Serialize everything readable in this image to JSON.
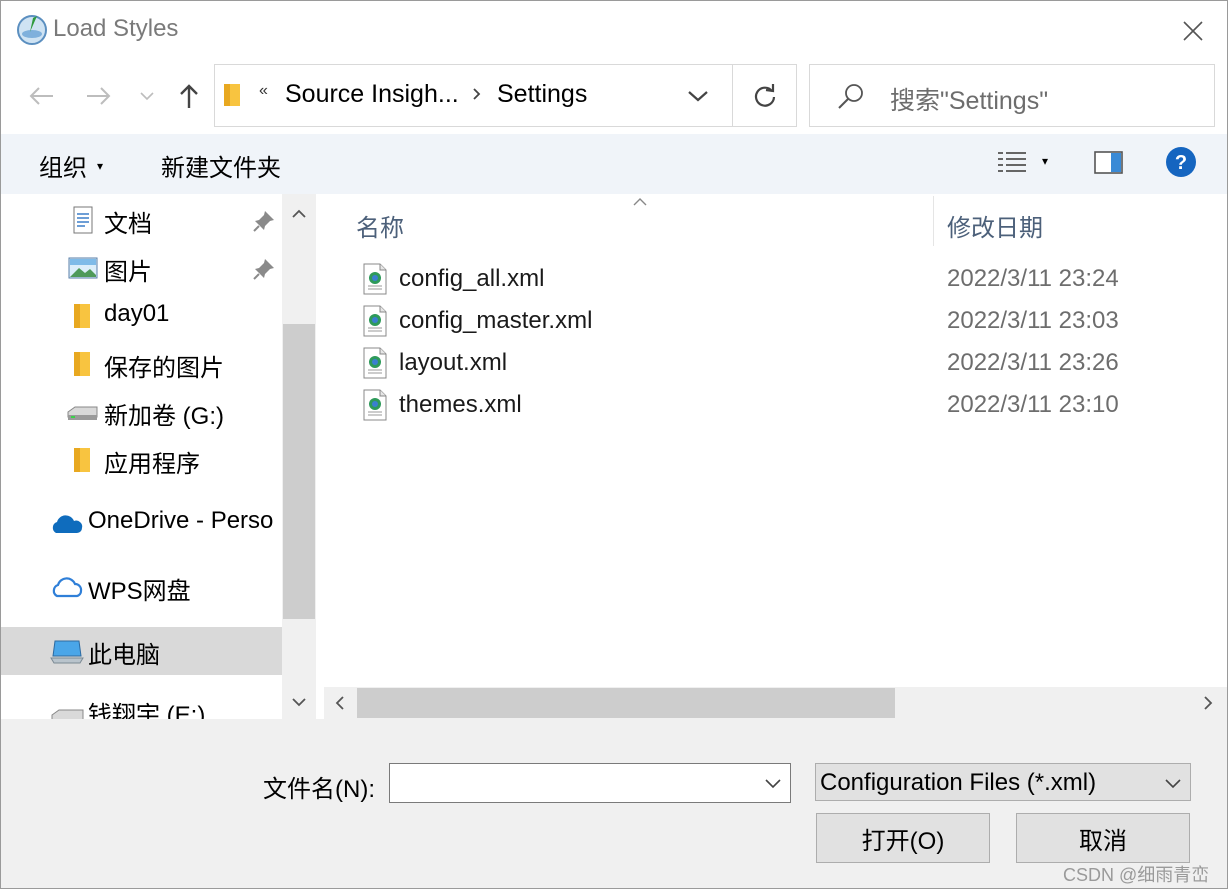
{
  "window": {
    "title": "Load Styles"
  },
  "address": {
    "overflow_chevron": "«",
    "crumbs": [
      "Source Insigh...",
      "Settings"
    ]
  },
  "search": {
    "placeholder": "搜索\"Settings\""
  },
  "toolbar": {
    "organize_label": "组织",
    "organize_caret": "▾",
    "new_folder_label": "新建文件夹",
    "view_caret": "▾"
  },
  "nav": {
    "items": [
      {
        "label": "文档",
        "icon": "document-icon",
        "pinned": true
      },
      {
        "label": "图片",
        "icon": "pictures-icon",
        "pinned": true
      },
      {
        "label": "day01",
        "icon": "folder-icon",
        "pinned": false
      },
      {
        "label": "保存的图片",
        "icon": "folder-icon",
        "pinned": false
      },
      {
        "label": "新加卷 (G:)",
        "icon": "drive-icon",
        "pinned": false
      },
      {
        "label": "应用程序",
        "icon": "folder-icon",
        "pinned": false
      },
      {
        "label": "OneDrive - Perso",
        "icon": "onedrive-icon",
        "pinned": false
      },
      {
        "label": "WPS网盘",
        "icon": "cloud-icon",
        "pinned": false
      },
      {
        "label": "此电脑",
        "icon": "computer-icon",
        "pinned": false,
        "selected": true
      },
      {
        "label": "钱翔宇 (E:)",
        "icon": "drive-icon",
        "pinned": false
      }
    ]
  },
  "filelist": {
    "columns": {
      "name": "名称",
      "date": "修改日期"
    },
    "files": [
      {
        "name": "config_all.xml",
        "date": "2022/3/11 23:24"
      },
      {
        "name": "config_master.xml",
        "date": "2022/3/11 23:03"
      },
      {
        "name": "layout.xml",
        "date": "2022/3/11 23:26"
      },
      {
        "name": "themes.xml",
        "date": "2022/3/11 23:10"
      }
    ]
  },
  "footer": {
    "filename_label": "文件名(N):",
    "filename_value": "",
    "filetype_value": "Configuration Files (*.xml)",
    "open_label": "打开(O)",
    "cancel_label": "取消",
    "watermark": "CSDN @细雨青峦"
  },
  "colors": {
    "toolbar_bg": "#f0f4f9",
    "help_blue": "#1565c0",
    "folder_yellow": "#f8c440",
    "selected_bg": "#d9d9d9",
    "header_text": "#4c607a"
  }
}
